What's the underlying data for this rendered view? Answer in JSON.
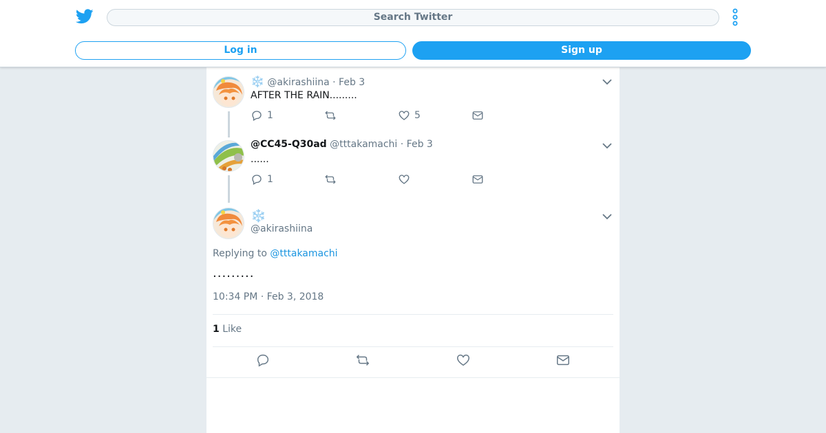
{
  "header": {
    "search_placeholder": "Search Twitter",
    "login_label": "Log in",
    "signup_label": "Sign up"
  },
  "tweets": [
    {
      "name": "❄️",
      "handle": "@akirashiina",
      "date": "· Feb 3",
      "text": "AFTER THE RAIN.........",
      "reply_count": "1",
      "retweet_count": "",
      "like_count": "5"
    },
    {
      "name": "@CC45-Q30ad",
      "handle": "@tttakamachi",
      "date": "· Feb 3",
      "text": "......",
      "reply_count": "1",
      "retweet_count": "",
      "like_count": ""
    }
  ],
  "main_tweet": {
    "name": "❄️",
    "handle": "@akirashiina",
    "replying_prefix": "Replying to",
    "replying_to": "@tttakamachi",
    "text": ".........",
    "timestamp": "10:34 PM · Feb 3, 2018",
    "like_count": "1",
    "like_label": "Like"
  },
  "colors": {
    "accent": "#1da1f2",
    "background": "#e6ecf0",
    "muted": "#657786"
  }
}
